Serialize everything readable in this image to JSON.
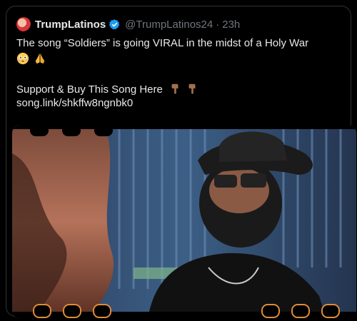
{
  "tweet": {
    "author_name": "TrumpLatinos",
    "author_handle": "@TrumpLatinos24",
    "separator": "·",
    "timestamp": "23h",
    "line1": "The song “Soldiers” is going VIRAL in the midst of a Holy War",
    "line1_emojis": [
      "flushed-face",
      "folded-hands"
    ],
    "line2": "Support & Buy This Song Here",
    "line2_emojis": [
      "backhand-index-pointing-down",
      "backhand-index-pointing-down"
    ],
    "link": "song.link/shkffw8ngnbk0"
  },
  "colors": {
    "background": "#000000",
    "text": "#e7e9ea",
    "muted": "#71767b",
    "verified": "#1d9bf0",
    "border": "#2f3336"
  }
}
